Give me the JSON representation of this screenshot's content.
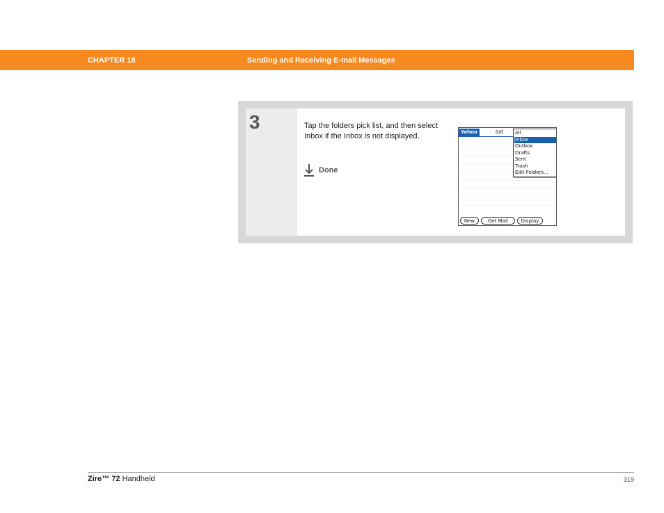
{
  "header": {
    "chapter": "CHAPTER 18",
    "title": "Sending and Receiving E-mail Messages",
    "bar_color": "#f6891f"
  },
  "step": {
    "number": "3",
    "instruction": "Tap the folders pick list, and then select Inbox if the Inbox is not displayed.",
    "done_label": "Done",
    "done_icon": "down-arrow-done-icon"
  },
  "palm": {
    "account": "Yahoo",
    "count": "0/0",
    "folders": [
      "All",
      "Inbox",
      "Outbox",
      "Drafts",
      "Sent",
      "Trash",
      "Edit Folders..."
    ],
    "selected_folder": "Inbox",
    "buttons": [
      "New",
      "Get Mail",
      "Display"
    ],
    "highlight_color": "#1a5fb4"
  },
  "footer": {
    "product_name": "Zire™",
    "product_model": "72",
    "product_suffix": "Handheld",
    "page": "319"
  }
}
